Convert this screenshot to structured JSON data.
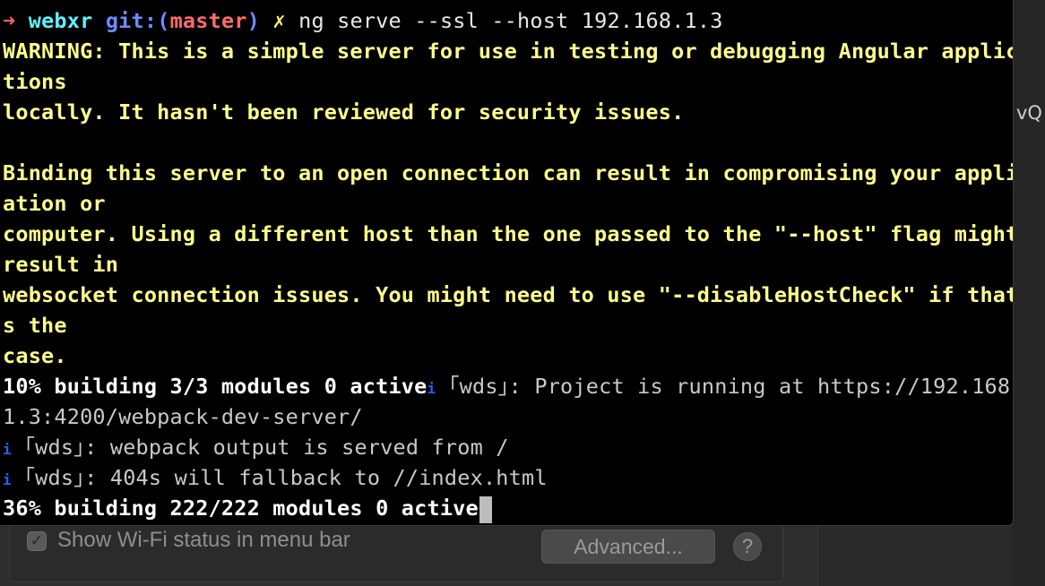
{
  "background": {
    "edge_text": "vQ",
    "wifi_checkbox_checked": true,
    "wifi_label": "Show Wi-Fi status in menu bar",
    "advanced_label": "Advanced...",
    "help_label": "?",
    "checkmark": "✓"
  },
  "terminal": {
    "prompt": {
      "arrow": "➜",
      "dir": "webxr",
      "git_prefix": "git:(",
      "branch": "master",
      "git_suffix": ")",
      "dirty_mark": "✗",
      "command": "ng serve --ssl --host 192.168.1.3"
    },
    "warning_lines": [
      "WARNING: This is a simple server for use in testing or debugging Angular applica",
      "tions",
      "locally. It hasn't been reviewed for security issues.",
      "",
      "Binding this server to an open connection can result in compromising your applic",
      "ation or",
      "computer. Using a different host than the one passed to the \"--host\" flag might",
      "result in",
      "websocket connection issues. You might need to use \"--disableHostCheck\" if that'",
      "s the",
      "case."
    ],
    "build1": "10% building 3/3 modules 0 active",
    "info_icon": "i",
    "wds_tag": "｢wds｣",
    "project_running": ": Project is running at https://192.168.",
    "project_running_cont": "1.3:4200/webpack-dev-server/",
    "output_served": ": webpack output is served from /",
    "fallback": ": 404s will fallback to //index.html",
    "build2": "36% building 222/222 modules 0 active"
  },
  "colors": {
    "terminal_bg": "#000000",
    "warning": "#fdfd8c",
    "prompt_arrow": "#ff5f5f",
    "dir": "#5ff1ff",
    "git": "#6c8cff",
    "branch": "#ff6b6b",
    "info_icon": "#2b5cff"
  }
}
